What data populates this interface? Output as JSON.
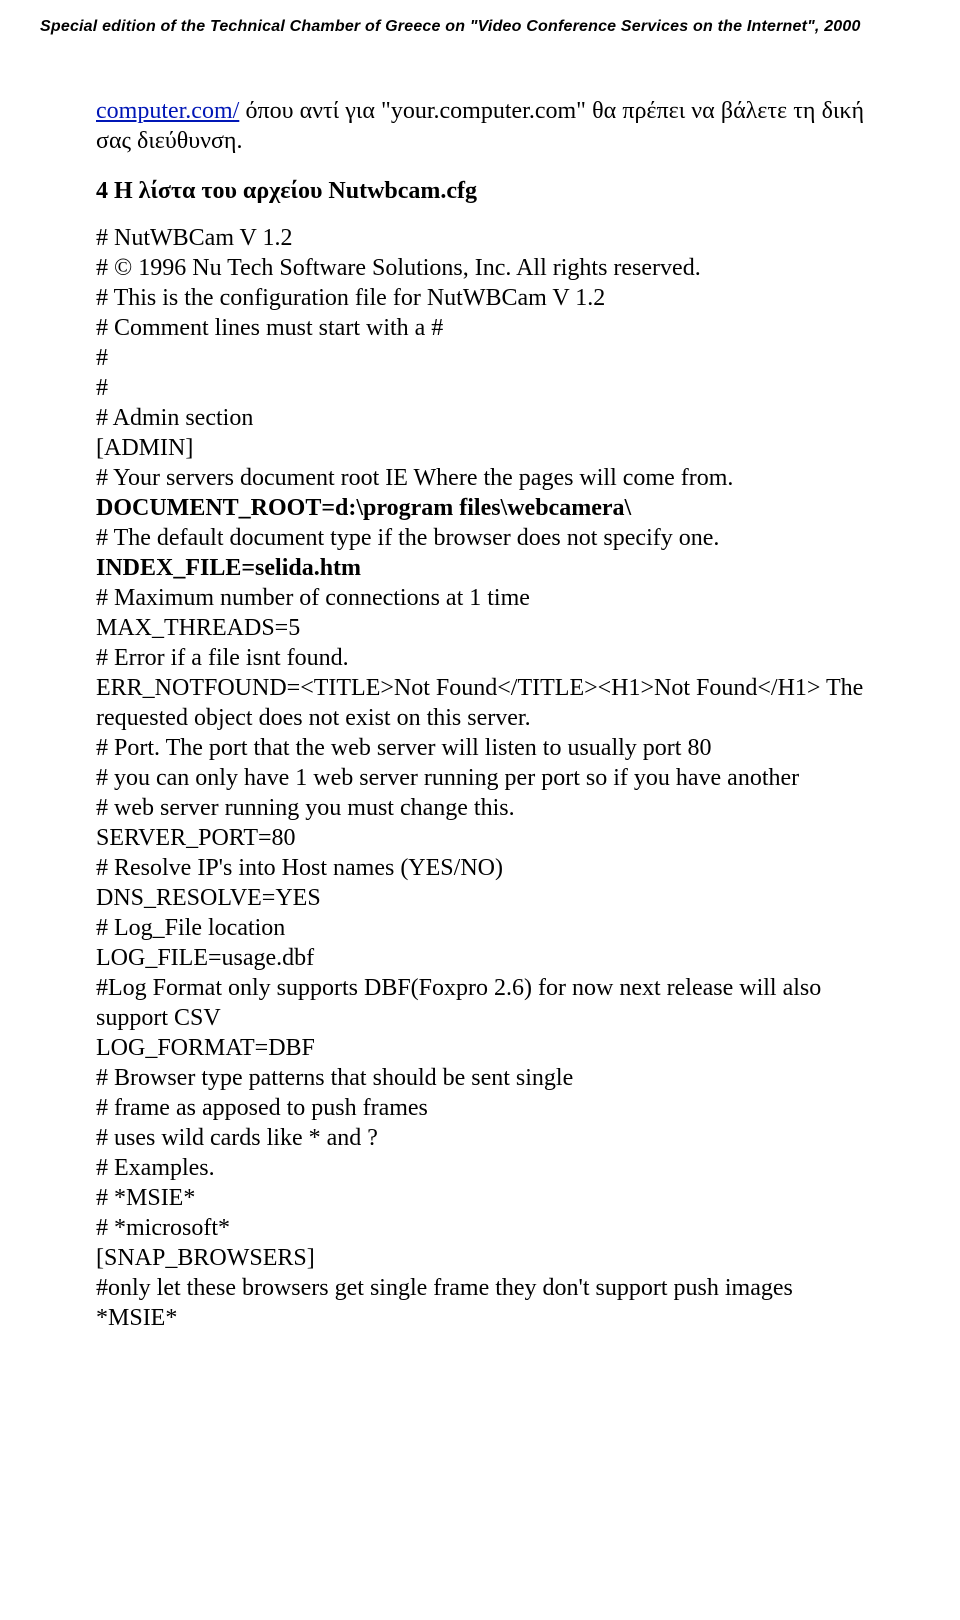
{
  "header": "Special edition of the Technical Chamber of Greece on \"Video Conference Services on the Internet\", 2000",
  "intro": {
    "link_text": "computer.com/",
    "rest": " όπου αντί για \"your.computer.com\" θα πρέπει να βάλετε τη δική σας διεύθυνση."
  },
  "section_title": "4 Η λίστα του αρχείου Nutwbcam.cfg",
  "cfg": {
    "l1": "# NutWBCam V 1.2",
    "l2": "# © 1996 Nu Tech Software Solutions, Inc. All rights reserved.",
    "l3": "# This is the configuration file for NutWBCam V 1.2",
    "l4": "# Comment lines must start with a #",
    "l5": "#",
    "l6": "#",
    "l7": "# Admin section",
    "l8": " [ADMIN]",
    "l9": "# Your servers document root IE Where the pages will come from.",
    "docroot": "DOCUMENT_ROOT=d:\\program files\\webcamera\\",
    "l10": "# The default document type if the browser does not specify one.",
    "indexfile": "INDEX_FILE=selida.htm",
    "l11": "# Maximum number of connections at 1 time",
    "l12": "MAX_THREADS=5",
    "l13": "# Error if a file isnt found.",
    "l14": "ERR_NOTFOUND=<TITLE>Not Found</TITLE><H1>Not Found</H1> The requested object does not exist on this server.",
    "l15": "# Port. The port that the web server will listen to usually port 80",
    "l16": "# you can only have 1 web server running per port so if you have another",
    "l17": "# web server running you must change this.",
    "l18": "SERVER_PORT=80",
    "l19": "# Resolve IP's into Host names (YES/NO)",
    "l20": "DNS_RESOLVE=YES",
    "l21": "# Log_File location",
    "l22": "LOG_FILE=usage.dbf",
    "l23": "#Log Format only supports DBF(Foxpro 2.6) for now next release will also support CSV",
    "l24": "LOG_FORMAT=DBF",
    "l25": "# Browser type patterns that should be sent single",
    "l26": "# frame as apposed to push frames",
    "l27": "# uses wild cards like * and ?",
    "l28": "# Examples.",
    "l29": "# *MSIE*",
    "l30": "# *microsoft*",
    "l31": "[SNAP_BROWSERS]",
    "l32": "#only let these browsers get single frame they don't support push images",
    "l33": "*MSIE*"
  }
}
